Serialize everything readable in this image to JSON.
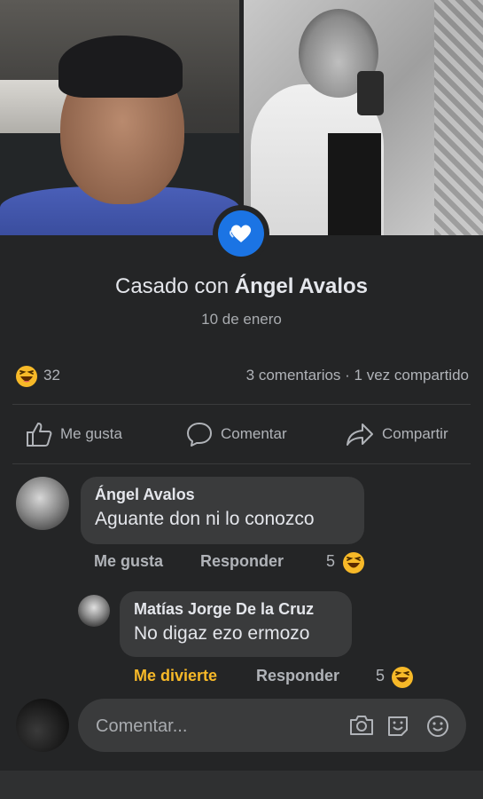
{
  "event": {
    "prefix": "Casado con ",
    "partner_name": "Ángel Avalos",
    "date": "10 de enero"
  },
  "reactions": {
    "count": "32",
    "stats": "3 comentarios · 1 vez compartido"
  },
  "actions": {
    "like": "Me gusta",
    "comment": "Comentar",
    "share": "Compartir"
  },
  "comments": [
    {
      "author": "Ángel Avalos",
      "text": "Aguante don ni lo conozco",
      "like_label": "Me gusta",
      "reply_label": "Responder",
      "reaction_count": "5"
    },
    {
      "author": "Matías Jorge De la Cruz",
      "text": "No digaz ezo ermozo",
      "like_label": "Me divierte",
      "reply_label": "Responder",
      "reaction_count": "5"
    }
  ],
  "composer": {
    "placeholder": "Comentar..."
  },
  "colors": {
    "background": "#242526",
    "bubble": "#3a3b3c",
    "accent_blue": "#1b74e4",
    "haha_yellow": "#f7b928"
  }
}
